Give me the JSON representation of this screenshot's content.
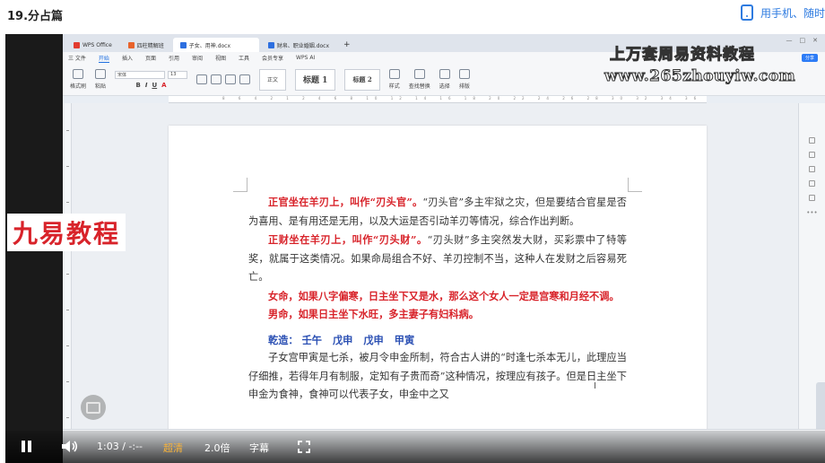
{
  "header": {
    "title": "19.分占篇",
    "phone_link": "用手机、随时"
  },
  "wps": {
    "tabs": [
      "WPS Office",
      "四柱精解班",
      "子女、用神.docx",
      "财帛、职业婚姻.docx"
    ],
    "menu": [
      "三 文件",
      "开始",
      "插入",
      "页面",
      "引用",
      "审阅",
      "视图",
      "工具",
      "会员专享",
      "WPS AI"
    ],
    "active_menu": "开始",
    "share": "分享",
    "font_name": "宋体",
    "font_size": "13",
    "styles": [
      "正文",
      "标题 1",
      "标题 2"
    ],
    "ribbon_groups": [
      "格式刷",
      "粘贴",
      "样式",
      "查找替换",
      "选择",
      "排版"
    ]
  },
  "watermark": {
    "title": "上万套周易资料教程",
    "url": "www.265zhouyiw.com",
    "logo": "九易教程"
  },
  "document": {
    "p1_red": "正官坐在羊刃上，叫作“刃头官”。",
    "p1_rest": "“刃头官”多主牢狱之灾，但是要结合官星是否为喜用、是有用还是无用，以及大运是否引动羊刃等情况，综合作出判断。",
    "p2_red": "正财坐在羊刃上，叫作“刃头财”。",
    "p2_rest": "“刃头财”多主突然发大财，买彩票中了特等奖，就属于这类情况。如果命局组合不好、羊刃控制不当，这种人在发财之后容易死亡。",
    "p3": "女命，如果八字偏寒，日主坐下又是水，那么这个女人一定是宫寒和月经不调。",
    "p4": "男命，如果日主坐下水旺，多主妻子有妇科病。",
    "bazi_label": "乾造：",
    "bazi": [
      "壬午",
      "戊申",
      "戊申",
      "甲寅"
    ],
    "p5": "子女宫甲寅是七杀，被月令申金所制，符合古人讲的“时逢七杀本无儿，此理应当仔细推，若得年月有制服，定知有子贵而奇”这种情况，按理应有孩子。但是日主坐下申金为食神，食神可以代表子女，申金中之又"
  },
  "player": {
    "time": "1:03 / -:--",
    "quality": "超清",
    "speed": "2.0倍",
    "subtitle": "字幕"
  }
}
